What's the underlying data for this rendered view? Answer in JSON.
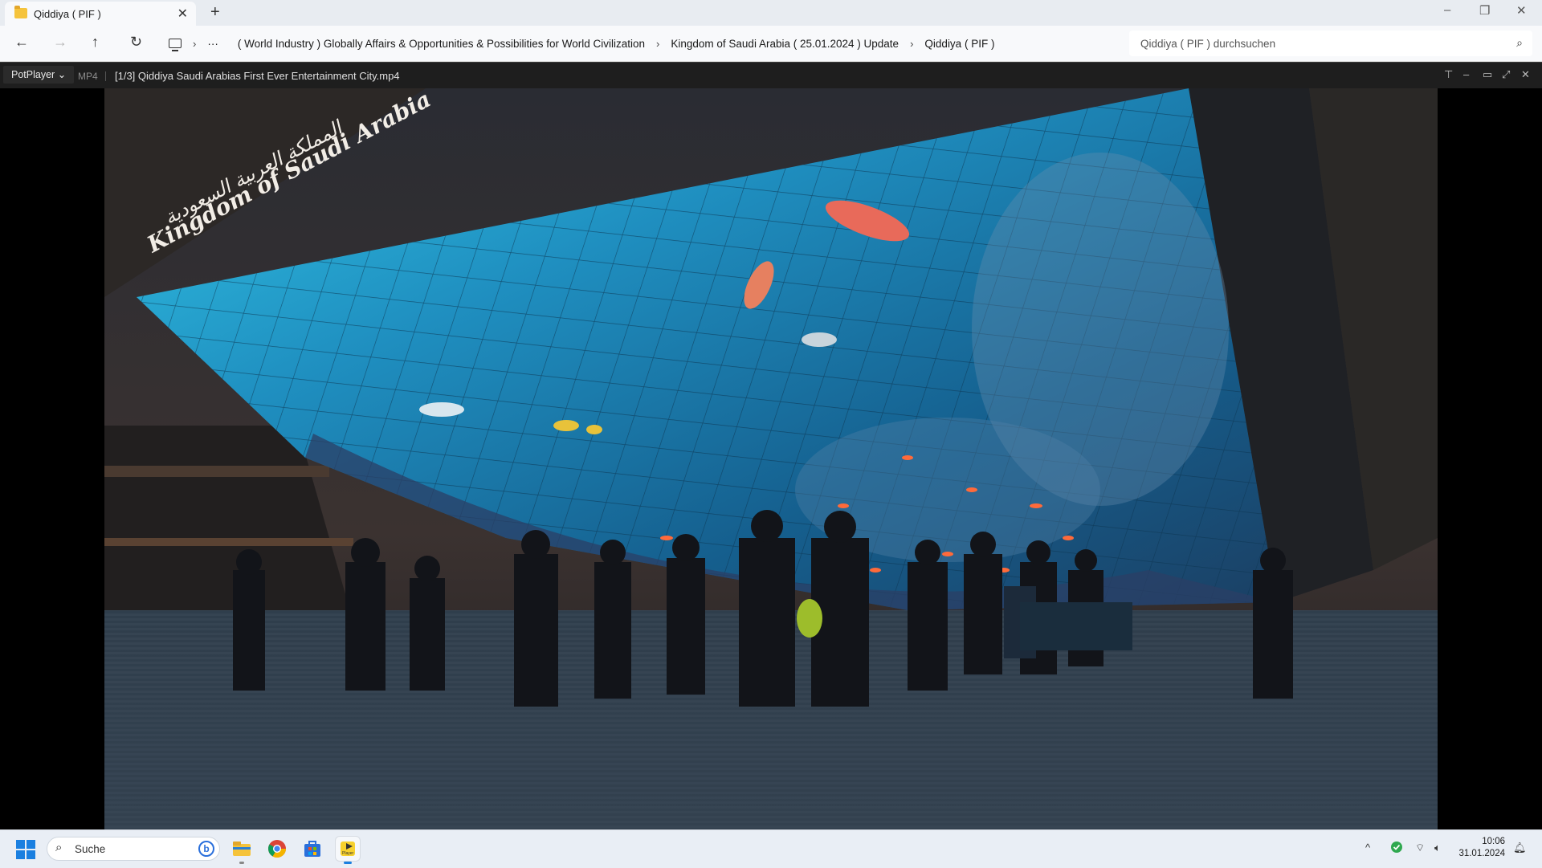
{
  "explorer": {
    "tab_title": "Qiddiya ( PIF )",
    "new_tab_glyph": "+",
    "close_glyph": "✕",
    "window_controls": [
      "–",
      "❐",
      "✕"
    ],
    "nav": {
      "back": "←",
      "forward": "→",
      "up": "↑",
      "refresh": "↻"
    },
    "breadcrumbs": [
      "( World Industry ) Globally Affairs & Opportunities & Possibilities for World Civilization",
      "Kingdom of Saudi Arabia ( 25.01.2024 ) Update",
      "Qiddiya ( PIF )"
    ],
    "overflow_glyph": "···",
    "search_placeholder": "Qiddiya ( PIF ) durchsuchen"
  },
  "player": {
    "app_label": "PotPlayer",
    "format": "MP4",
    "file_title": "[1/3] Qiddiya  Saudi Arabias First Ever Entertainment City.mp4",
    "controls": [
      "⊤",
      "–",
      "▭",
      "⤢",
      "✕"
    ],
    "video_text": {
      "arabic": "المملكة العربية السعودية",
      "english": "Kingdom of Saudi Arabia"
    }
  },
  "taskbar": {
    "search_label": "Suche",
    "tray_chevron": "^",
    "time": "10:06",
    "date": "31.01.2024",
    "apps": [
      "file-explorer",
      "chrome",
      "microsoft-store",
      "potplayer"
    ],
    "potplayer_label": "Player"
  },
  "colors": {
    "accent": "#1a7fe0",
    "player_bar": "#1e1e1e",
    "taskbar": "#e9eef5"
  }
}
